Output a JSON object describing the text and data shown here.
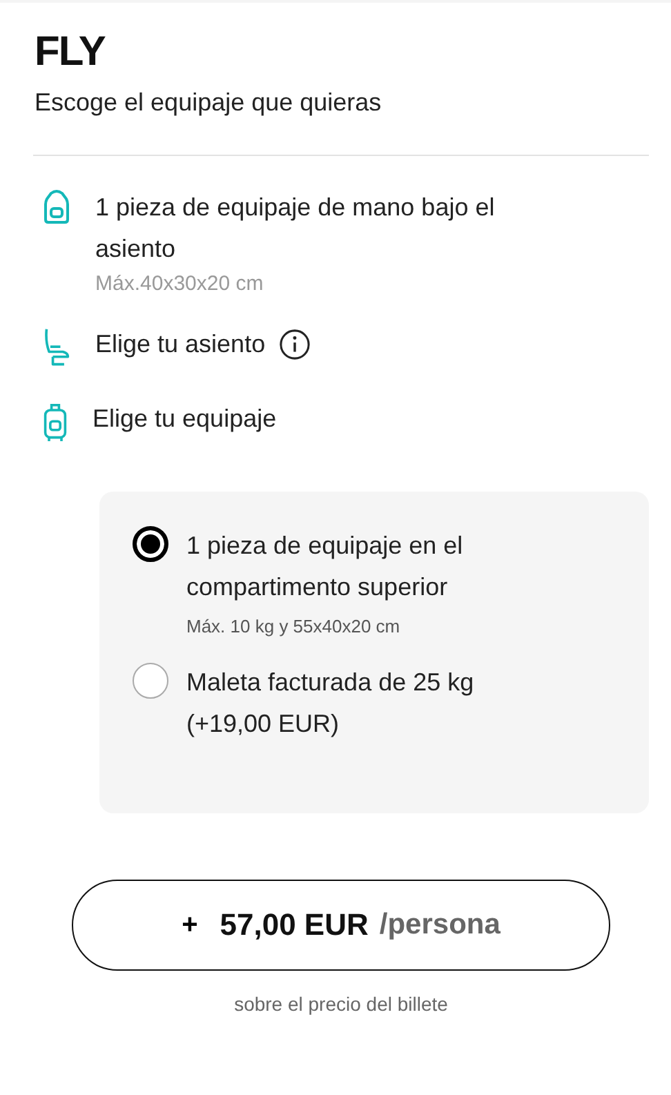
{
  "title": "FLY",
  "subtitle": "Escoge el equipaje que quieras",
  "features": [
    {
      "kind": "backpack",
      "text": "1 pieza de equipaje de mano bajo el asiento",
      "detail": "Máx.40x30x20 cm",
      "info": false
    },
    {
      "kind": "seat",
      "text": "Elige tu asiento",
      "info": true
    },
    {
      "kind": "suitcase",
      "text": "Elige tu equipaje",
      "info": false
    }
  ],
  "options": [
    {
      "label": "1 pieza de equipaje en el compartimento superior",
      "detail": "Máx. 10 kg y 55x40x20 cm",
      "selected": true
    },
    {
      "label": "Maleta facturada de 25 kg (+19,00 EUR)",
      "selected": false
    }
  ],
  "price_button": {
    "plus": "+",
    "amount": "57,00 EUR",
    "unit": "/persona"
  },
  "footnote": "sobre el precio del billete"
}
